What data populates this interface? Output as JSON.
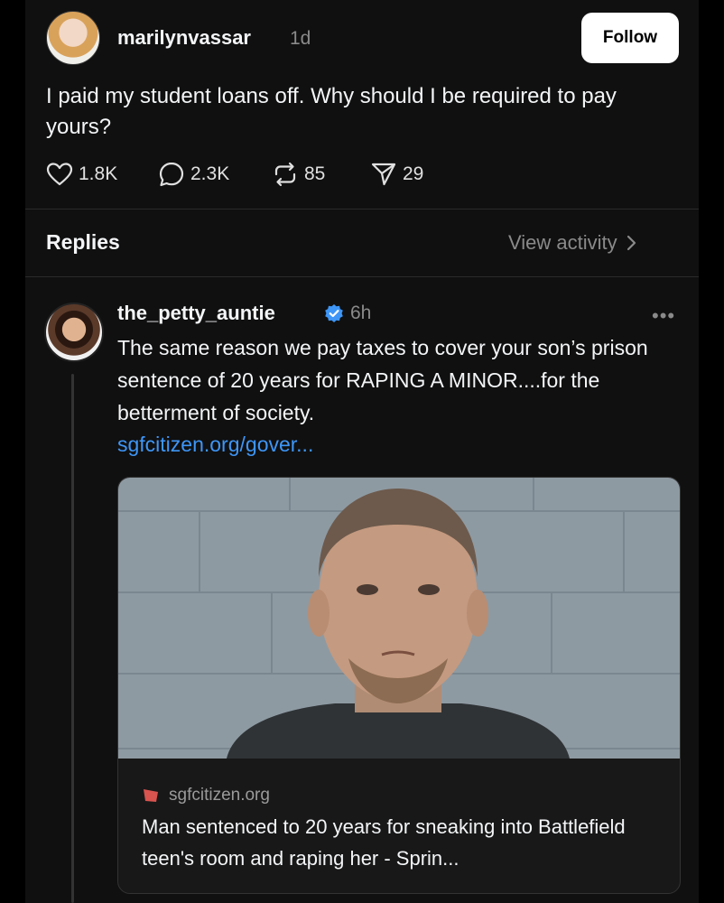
{
  "original_post": {
    "username": "marilynvassar",
    "time": "1d",
    "follow_label": "Follow",
    "text": "I paid my student loans off. Why should I be required to pay yours?",
    "stats": {
      "likes": "1.8K",
      "comments": "2.3K",
      "reposts": "85",
      "shares": "29"
    }
  },
  "replies_header": {
    "label": "Replies",
    "view_activity": "View activity"
  },
  "reply": {
    "username": "the_petty_auntie",
    "time": "6h",
    "text": "The same reason we pay taxes to cover your son’s prison sentence of 20 years for RAPING A MINOR....for the betterment of society.",
    "link_text": "sgfcitizen.org/gover...",
    "card": {
      "domain": "sgfcitizen.org",
      "title": "Man sentenced to 20 years for sneaking into Battlefield teen's room and raping her - Sprin..."
    }
  },
  "colors": {
    "background": "#101010",
    "link": "#3e96f7",
    "verified": "#3e96f7",
    "muted": "#8a8a8a"
  },
  "icons": [
    "heart-icon",
    "comment-icon",
    "repost-icon",
    "share-icon",
    "chevron-right-icon",
    "verified-badge-icon",
    "more-icon",
    "site-favicon-icon"
  ]
}
